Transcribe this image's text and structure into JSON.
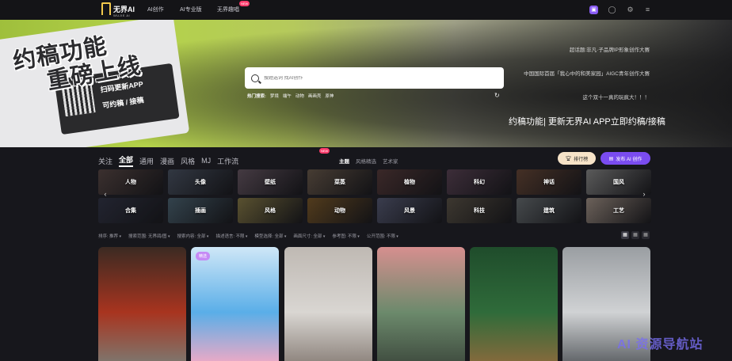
{
  "nav": {
    "logo_text": "无界AI",
    "logo_sub": "WUJIE AI",
    "links": [
      "AI创作",
      "AI专业版",
      "无界趣唱"
    ],
    "hot_tag": "NEW"
  },
  "banner": {
    "headline_line1": "约稿功能",
    "headline_line2": "重磅上线",
    "ticket_line1": "扫码更新APP",
    "ticket_line2": "可约稿 / 接稿",
    "search_placeholder": "搜题选词 找AI创作",
    "hot_label": "热门搜索:",
    "hot_terms": [
      "梦境",
      "端午",
      "动物",
      "画画壳",
      "原神"
    ],
    "notices": [
      "超话题:非凡·子品牌IP形象创作大赛",
      "中国国际首届「我心中的和美家园」AIGC青年创作大赛",
      "这个双十一真的玩疯大！！！"
    ],
    "caption": "约稿功能| 更新无界AI APP立即约稿/接稿"
  },
  "tabs": {
    "items": [
      "关注",
      "全部",
      "通用",
      "漫画",
      "风格",
      "MJ",
      "工作流"
    ],
    "active_index": 1,
    "hot_tag": "NEW"
  },
  "subtabs": [
    "主题",
    "风格精选",
    "艺术家"
  ],
  "buttons": {
    "rank": "排行榜",
    "publish": "发布 AI 创作"
  },
  "categories": [
    {
      "label": "人物",
      "color": "#5b4a48"
    },
    {
      "label": "头像",
      "color": "#4d5666"
    },
    {
      "label": "壁纸",
      "color": "#6a5a66"
    },
    {
      "label": "菜蒸",
      "color": "#6d5d4f"
    },
    {
      "label": "植物",
      "color": "#5a3e3e"
    },
    {
      "label": "科幻",
      "color": "#5d4658"
    },
    {
      "label": "神话",
      "color": "#6a4a3a"
    },
    {
      "label": "国风",
      "color": "#8b8b8b"
    },
    {
      "label": "合集",
      "color": "#35384a"
    },
    {
      "label": "插画",
      "color": "#4f6776"
    },
    {
      "label": "风格",
      "color": "#8a7d4a"
    },
    {
      "label": "动物",
      "color": "#7d5b2c"
    },
    {
      "label": "风景",
      "color": "#5a5e78"
    },
    {
      "label": "科技",
      "color": "#5e564a"
    },
    {
      "label": "建筑",
      "color": "#6c7276"
    },
    {
      "label": "工艺",
      "color": "#a6968b"
    }
  ],
  "filters": [
    "排序: 推荐",
    "搜索范围: 无界鸽/图",
    "搜索内容: 全部",
    "描述语言: 不限",
    "模型选择: 全部",
    "画面尺寸: 全部",
    "参考图: 不限",
    "公开范围: 不限"
  ],
  "view_modes": [
    "grid-large",
    "grid-medium",
    "grid-small"
  ],
  "cards": [
    {
      "tag": "",
      "colors": [
        "#a8341f",
        "#3b2a22",
        "#7c7a72"
      ]
    },
    {
      "tag": "精选",
      "colors": [
        "#5aaee8",
        "#cfe7f7",
        "#f4a9c4"
      ]
    },
    {
      "tag": "",
      "colors": [
        "#d9d6d2",
        "#bfb9b3",
        "#8a8079"
      ]
    },
    {
      "tag": "",
      "colors": [
        "#6c8a6c",
        "#d68f8f",
        "#3e4a3e"
      ]
    },
    {
      "tag": "",
      "colors": [
        "#2f6b3a",
        "#1f4c2b",
        "#8a6a3c"
      ]
    },
    {
      "tag": "",
      "colors": [
        "#d0d2d4",
        "#9a9ea2",
        "#5a5e62"
      ]
    }
  ],
  "watermark": "AI 资源导航站"
}
